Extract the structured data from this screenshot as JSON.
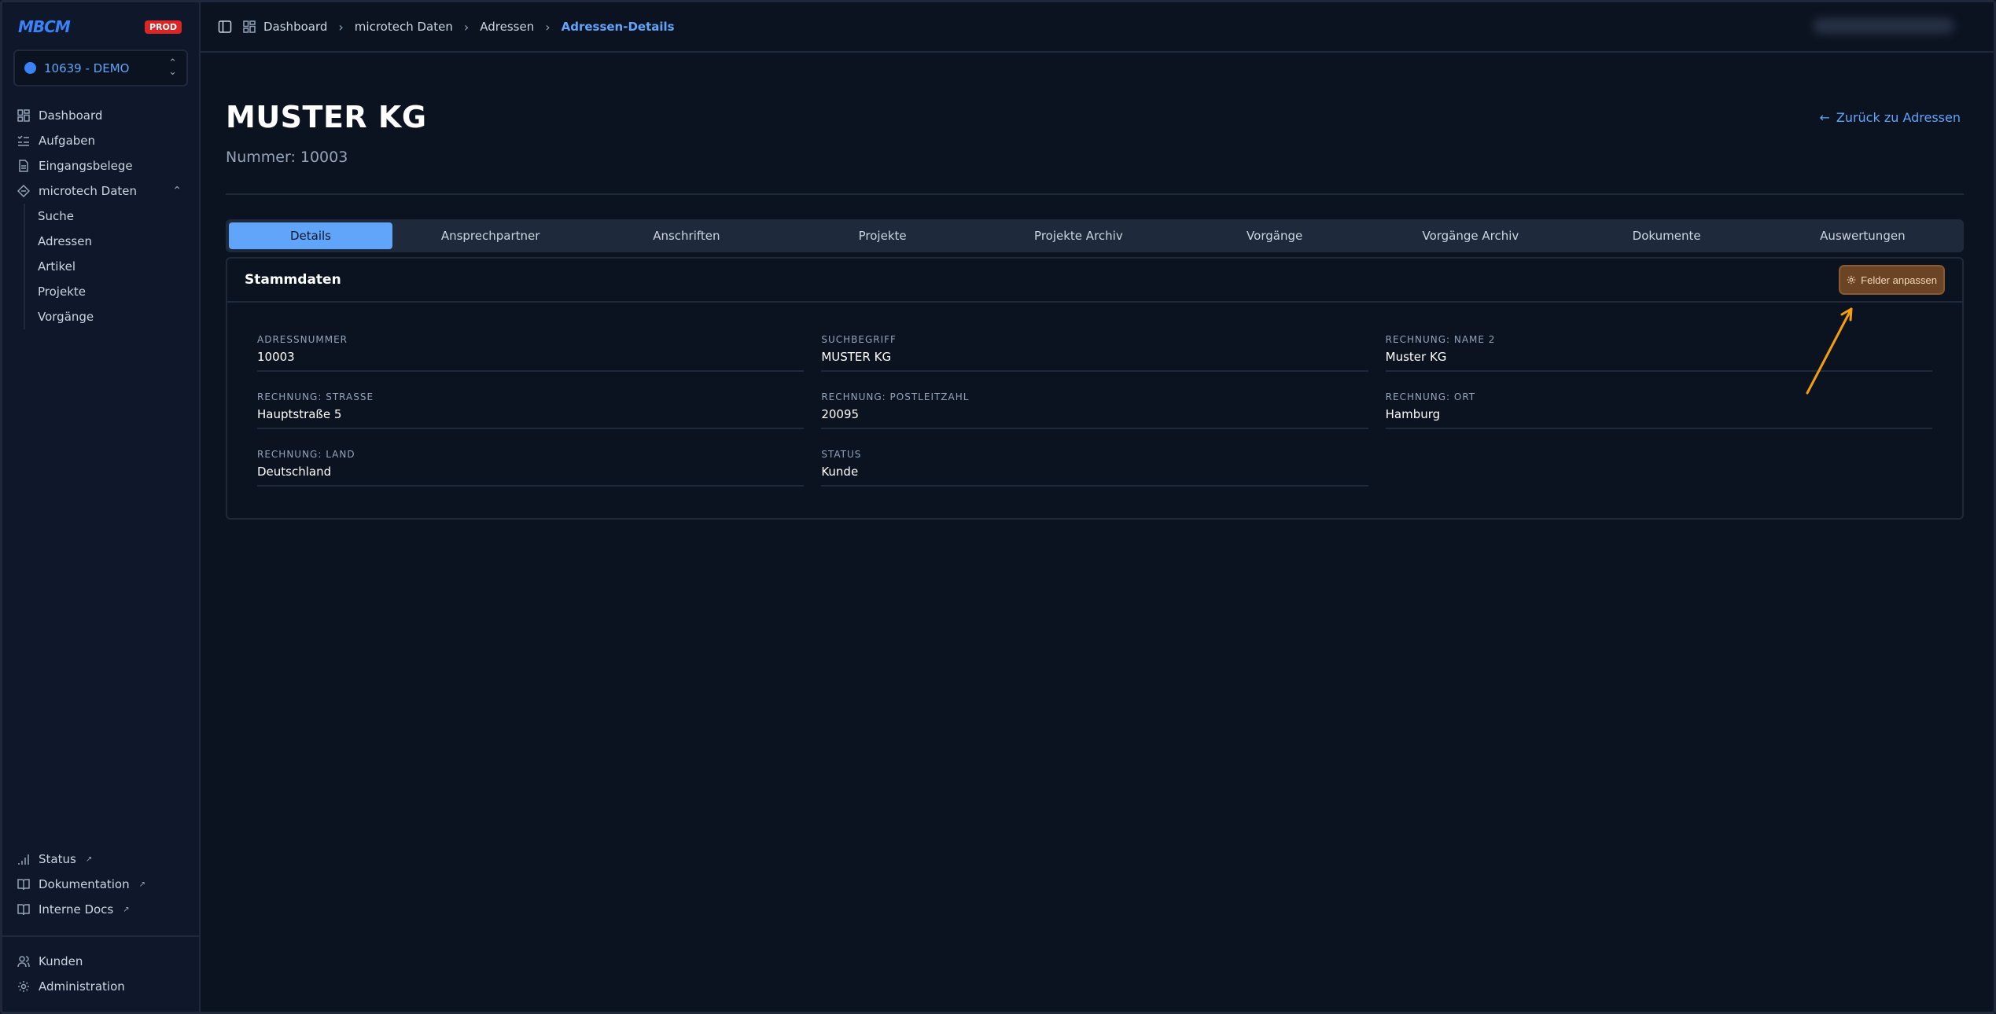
{
  "brand": {
    "logo_text": "MBCM",
    "env_badge": "PROD"
  },
  "org_selector": {
    "label": "10639 - DEMO"
  },
  "sidebar": {
    "items": [
      {
        "label": "Dashboard",
        "icon": "dashboard-icon"
      },
      {
        "label": "Aufgaben",
        "icon": "tasks-icon"
      },
      {
        "label": "Eingangsbelege",
        "icon": "document-icon"
      },
      {
        "label": "microtech Daten",
        "icon": "data-icon"
      }
    ],
    "subitems": [
      "Suche",
      "Adressen",
      "Artikel",
      "Projekte",
      "Vorgänge"
    ],
    "footer_links": [
      {
        "label": "Status",
        "icon": "signal-icon"
      },
      {
        "label": "Dokumentation",
        "icon": "book-icon"
      },
      {
        "label": "Interne Docs",
        "icon": "book-icon"
      }
    ],
    "bottom_items": [
      {
        "label": "Kunden",
        "icon": "users-icon"
      },
      {
        "label": "Administration",
        "icon": "gear-icon"
      }
    ]
  },
  "breadcrumb": {
    "items": [
      "Dashboard",
      "microtech Daten",
      "Adressen"
    ],
    "current": "Adressen-Details"
  },
  "page": {
    "title": "MUSTER KG",
    "subtitle": "Nummer: 10003",
    "back_label": "Zurück zu Adressen"
  },
  "tabs": [
    "Details",
    "Ansprechpartner",
    "Anschriften",
    "Projekte",
    "Projekte Archiv",
    "Vorgänge",
    "Vorgänge Archiv",
    "Dokumente",
    "Auswertungen"
  ],
  "card": {
    "title": "Stammdaten",
    "button_label": "Felder anpassen",
    "fields": [
      {
        "label": "ADRESSNUMMER",
        "value": "10003"
      },
      {
        "label": "SUCHBEGRIFF",
        "value": "MUSTER KG"
      },
      {
        "label": "RECHNUNG: NAME 2",
        "value": "Muster KG"
      },
      {
        "label": "RECHNUNG: STRASSE",
        "value": "Hauptstraße 5"
      },
      {
        "label": "RECHNUNG: POSTLEITZAHL",
        "value": "20095"
      },
      {
        "label": "RECHNUNG: ORT",
        "value": "Hamburg"
      },
      {
        "label": "RECHNUNG: LAND",
        "value": "Deutschland"
      },
      {
        "label": "STATUS",
        "value": "Kunde"
      }
    ]
  },
  "colors": {
    "accent": "#60a5fa",
    "badge": "#dc2626",
    "highlight_button": "#6b4426",
    "annotation_arrow": "#f59e0b"
  }
}
